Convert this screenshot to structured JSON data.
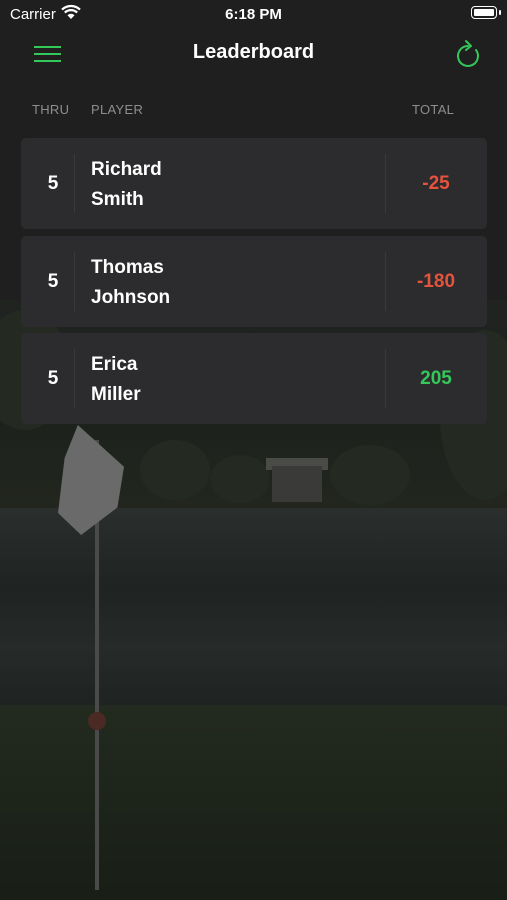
{
  "status_bar": {
    "carrier": "Carrier",
    "time": "6:18 PM"
  },
  "nav": {
    "title": "Leaderboard",
    "menu_icon": "hamburger-menu-icon",
    "refresh_icon": "refresh-icon",
    "accent_color": "#34c759"
  },
  "columns": {
    "thru": "THRU",
    "player": "PLAYER",
    "total": "TOTAL"
  },
  "players": [
    {
      "thru": "5",
      "first_name": "Richard",
      "last_name": "Smith",
      "total": "-25",
      "total_color": "#e5533d"
    },
    {
      "thru": "5",
      "first_name": "Thomas",
      "last_name": "Johnson",
      "total": "-180",
      "total_color": "#e5533d"
    },
    {
      "thru": "5",
      "first_name": "Erica",
      "last_name": "Miller",
      "total": "205",
      "total_color": "#34c759"
    }
  ]
}
